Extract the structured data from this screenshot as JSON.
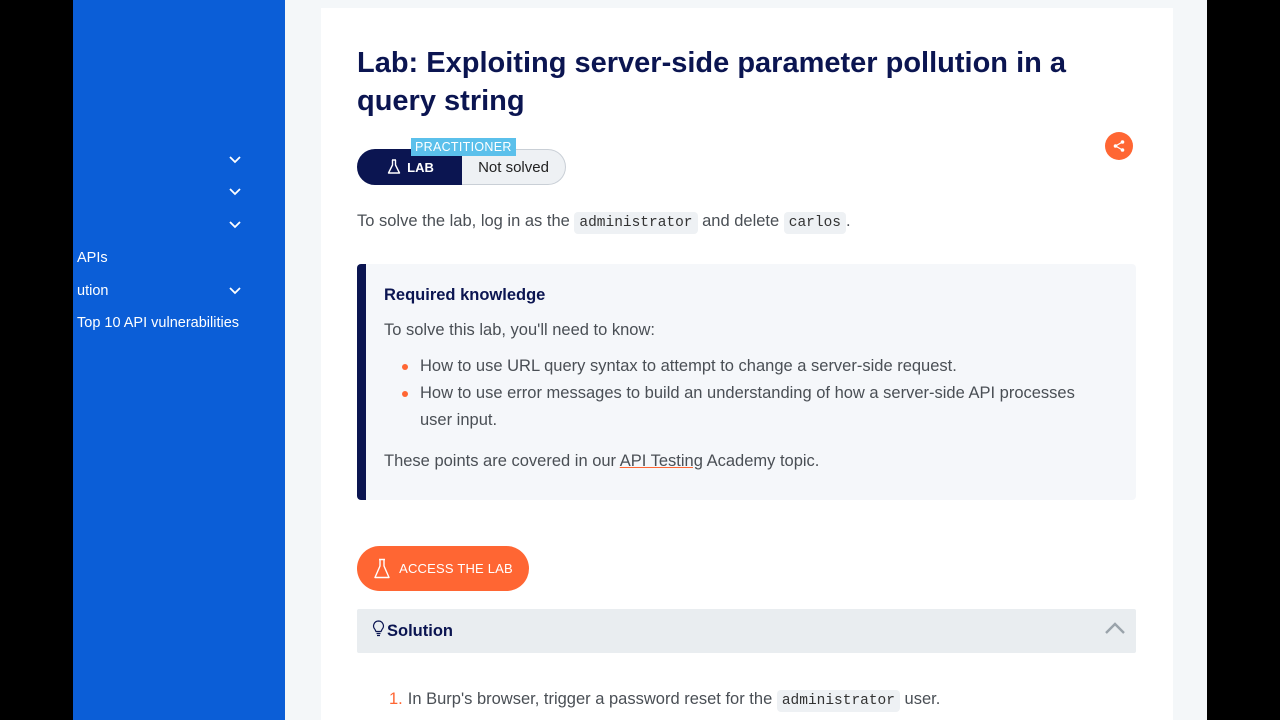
{
  "sidebar": {
    "items": [
      {
        "label": "",
        "has_chevron": true
      },
      {
        "label": "",
        "has_chevron": true
      },
      {
        "label": "",
        "has_chevron": true
      },
      {
        "label": "APIs",
        "has_chevron": false
      },
      {
        "label": "ution",
        "has_chevron": true
      },
      {
        "label": "Top 10 API vulnerabilities",
        "has_chevron": false
      }
    ]
  },
  "lab": {
    "title": "Lab: Exploiting server-side parameter pollution in a query string",
    "badge_type": "LAB",
    "badge_level": "PRACTITIONER",
    "status": "Not solved",
    "intro": {
      "prefix": "To solve the lab, log in as the ",
      "code1": "administrator",
      "middle": " and delete ",
      "code2": "carlos",
      "suffix": "."
    }
  },
  "knowledge": {
    "title": "Required knowledge",
    "lead": "To solve this lab, you'll need to know:",
    "items": [
      "How to use URL query syntax to attempt to change a server-side request.",
      "How to use error messages to build an understanding of how a server-side API processes user input."
    ],
    "note_prefix": "These points are covered in our ",
    "note_link": "API Testing",
    "note_suffix": " Academy topic."
  },
  "access_button": "ACCESS THE LAB",
  "solution": {
    "label": "Solution",
    "steps": [
      {
        "num": "1.",
        "prefix": "In Burp's browser, trigger a password reset for the ",
        "code": "administrator",
        "suffix": " user."
      }
    ]
  },
  "colors": {
    "sidebar": "#0b5ed7",
    "navy": "#0b1551",
    "accent": "#ff6633",
    "level_badge": "#5bc0eb"
  },
  "icons": {
    "close": "close-icon",
    "chevron": "chevron-down-icon",
    "flask": "flask-icon",
    "share": "share-icon",
    "lightbulb": "lightbulb-icon",
    "collapse": "chevron-up-icon"
  }
}
